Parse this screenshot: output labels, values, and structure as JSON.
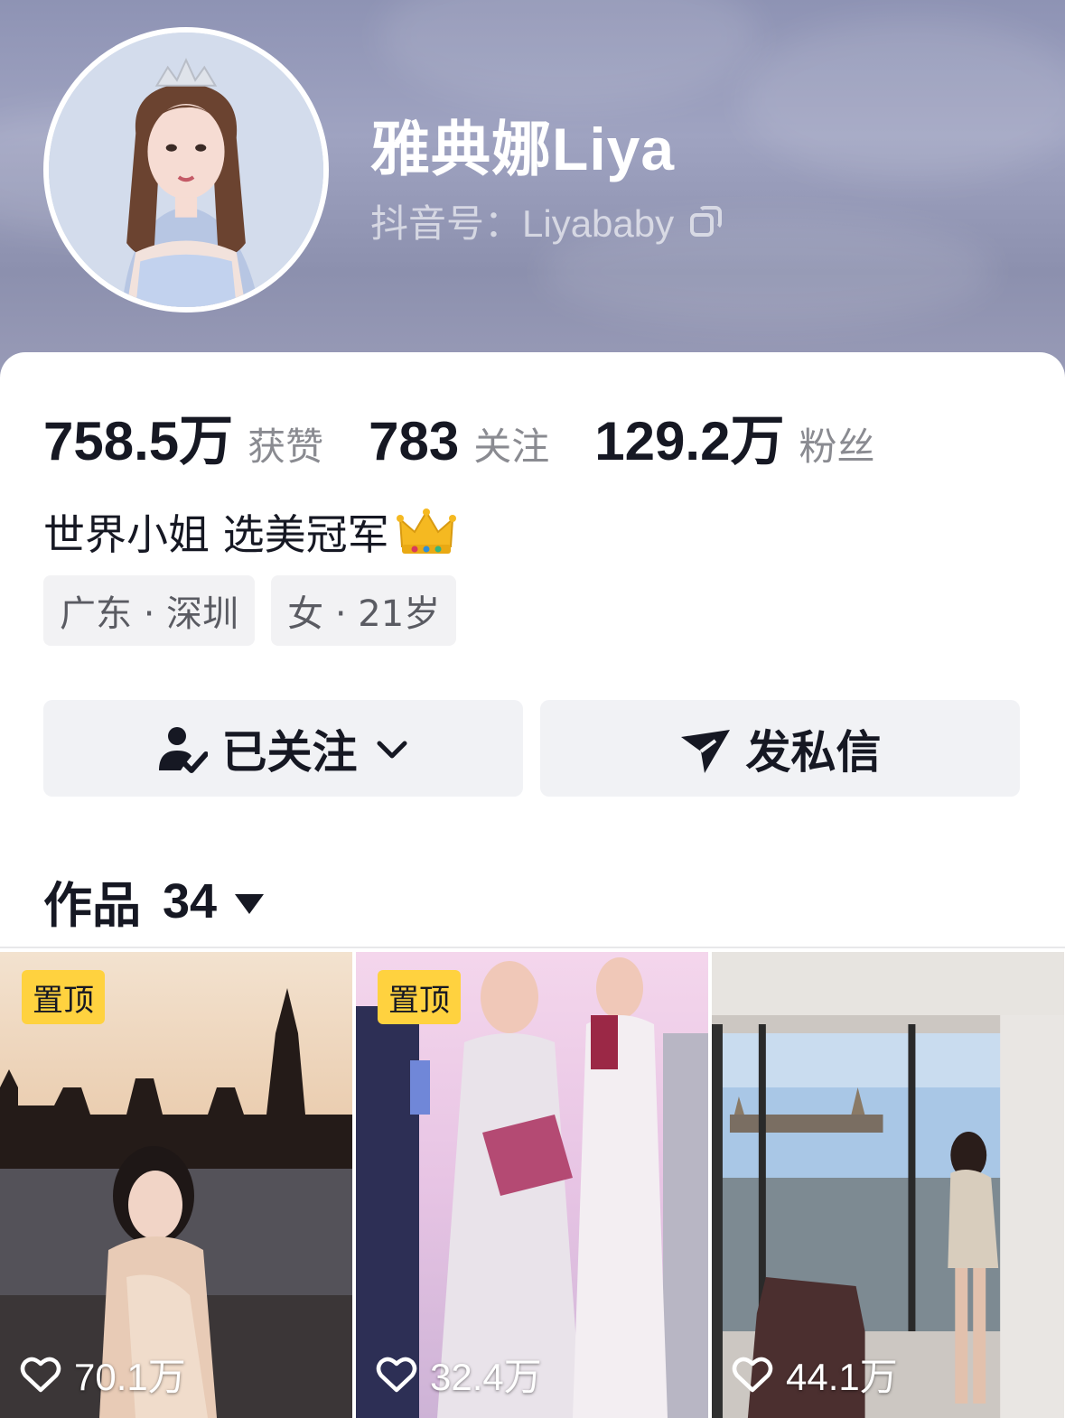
{
  "profile": {
    "nickname": "雅典娜Liya",
    "douyin_id": "抖音号：Liyababy",
    "stats": [
      {
        "value": "758.5万",
        "label": "获赞"
      },
      {
        "value": "783",
        "label": "关注"
      },
      {
        "value": "129.2万",
        "label": "粉丝"
      }
    ],
    "bio": "世界小姐 选美冠军",
    "tags": [
      "广东 · 深圳",
      "女 · 21岁"
    ]
  },
  "actions": {
    "follow_label": "已关注",
    "message_label": "发私信"
  },
  "works": {
    "title": "作品",
    "count": "34",
    "items": [
      {
        "pinned": "置顶",
        "likes": "70.1万"
      },
      {
        "pinned": "置顶",
        "likes": "32.4万"
      },
      {
        "pinned": "",
        "likes": "44.1万"
      }
    ]
  },
  "icons": {
    "copy": "copy-icon",
    "crown": "crown-icon",
    "follow": "user-check-icon",
    "message": "send-icon",
    "like": "heart-icon"
  },
  "colors": {
    "pin_badge": "#ffd23f",
    "button_bg": "#f1f2f5",
    "tag_bg": "#f2f2f4"
  }
}
